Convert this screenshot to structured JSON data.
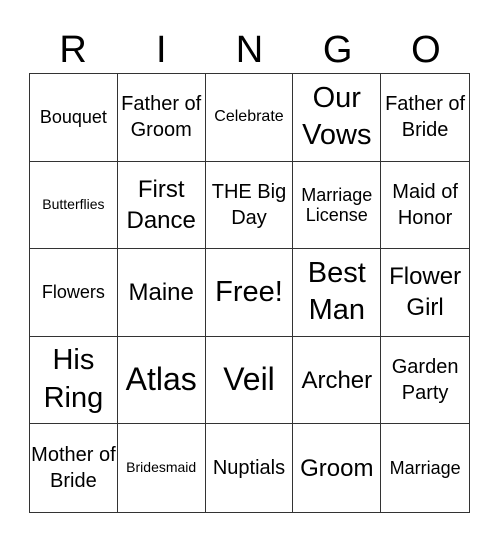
{
  "header": {
    "letters": [
      "R",
      "I",
      "N",
      "G",
      "O"
    ]
  },
  "cells": [
    "Bouquet",
    "Father of Groom",
    "Celebrate",
    "Our Vows",
    "Father of Bride",
    "Butterflies",
    "First Dance",
    "THE Big Day",
    "Marriage License",
    "Maid of Honor",
    "Flowers",
    "Maine",
    "Free!",
    "Best Man",
    "Flower Girl",
    "His Ring",
    "Atlas",
    "Veil",
    "Archer",
    "Garden Party",
    "Mother of Bride",
    "Bridesmaid",
    "Nuptials",
    "Groom",
    "Marriage"
  ]
}
